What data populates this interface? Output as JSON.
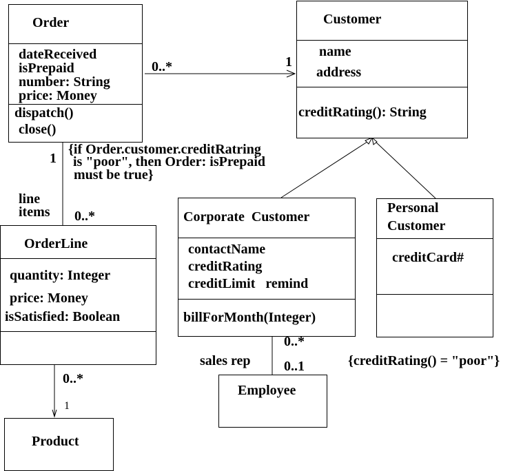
{
  "classes": {
    "order": {
      "name": "Order",
      "attributes": [
        "dateReceived",
        "isPrepaid",
        "number: String",
        "price: Money"
      ],
      "operations": [
        "dispatch()",
        "close()"
      ]
    },
    "customer": {
      "name": "Customer",
      "attributes": [
        "name",
        "address"
      ],
      "operations": [
        "creditRating(): String"
      ]
    },
    "order_line": {
      "name": "OrderLine",
      "attributes": [
        "quantity: Integer",
        "price: Money",
        "isSatisfied: Boolean"
      ],
      "operations": []
    },
    "corporate_customer": {
      "name": "Corporate  Customer",
      "attributes": [
        "contactName",
        "creditRating",
        "creditLimit   remind"
      ],
      "operations": [
        "billForMonth(Integer)"
      ]
    },
    "personal_customer": {
      "name_lines": [
        "Personal",
        "Customer"
      ],
      "attributes": [
        "creditCard#"
      ],
      "operations": []
    },
    "employee": {
      "name": "Employee"
    },
    "product": {
      "name": "Product"
    }
  },
  "associations": {
    "order_customer": {
      "source_mult": "0..*",
      "target_mult": "1"
    },
    "order_orderline": {
      "source_mult": "1",
      "role": "line items",
      "role_lines": [
        "line",
        "items"
      ],
      "target_mult": "0..*",
      "constraint_lines": [
        "{if Order.customer.creditRatring",
        "is \"poor\", then Order: isPrepaid",
        "must be true}"
      ]
    },
    "orderline_product": {
      "source_mult": "0..*",
      "target_mult": "1"
    },
    "corporate_employee": {
      "source_mult": "0..*",
      "role": "sales rep",
      "target_mult": "0..1",
      "constraint": "{creditRating() = \"poor\"}"
    }
  }
}
